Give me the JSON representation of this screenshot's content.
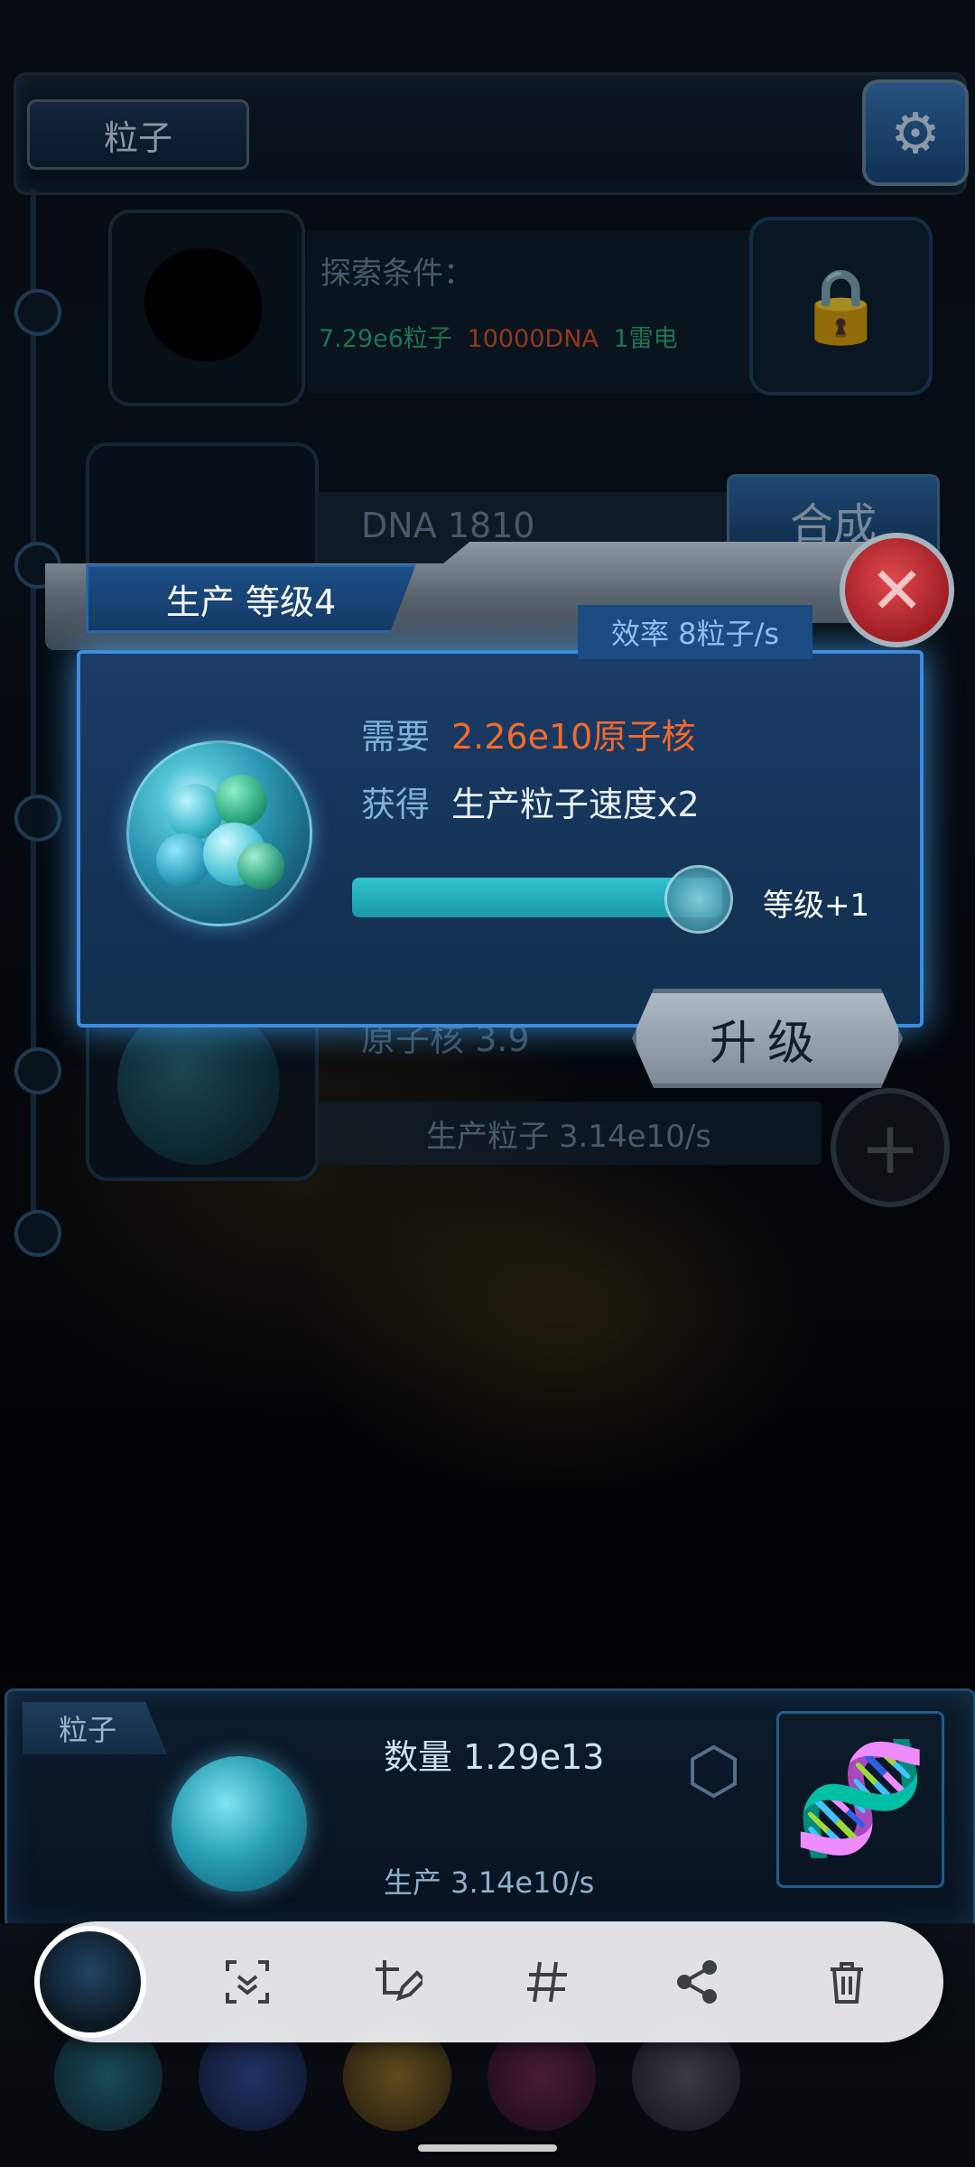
{
  "header": {
    "particles_tab": "粒子",
    "settings_icon": "gear-icon"
  },
  "explore": {
    "title": "探索条件：",
    "req_particles": "7.29e6粒子",
    "req_dna": "10000DNA",
    "req_thunder": "1雷电",
    "colors": {
      "particles": "#2fb37a",
      "dna": "#e2562a",
      "thunder": "#2fb37a"
    }
  },
  "production": {
    "dna_label": "DNA 1810",
    "synthesize_label": "合成",
    "nucleus_label": "原子核 3.9",
    "produce_rate": "生产粒子 3.14e10/s"
  },
  "dialog": {
    "title": "生产 等级4",
    "efficiency": "效率 8粒子/s",
    "need_label": "需要",
    "need_value": "2.26e10原子核",
    "get_label": "获得",
    "get_value": "生产粒子速度x2",
    "level_plus": "等级+1",
    "upgrade_label": "升级",
    "progress": 1.0,
    "colors": {
      "need_value": "#f26a2e",
      "glow": "#3c8de0"
    }
  },
  "resource": {
    "tab_label": "粒子",
    "count_label": "数量 1.29e13",
    "rate_label": "生产 3.14e10/s"
  },
  "toolbar": {
    "items": [
      "scroll-capture-icon",
      "edit-crop-icon",
      "hashtag-icon",
      "share-icon",
      "delete-icon"
    ]
  }
}
